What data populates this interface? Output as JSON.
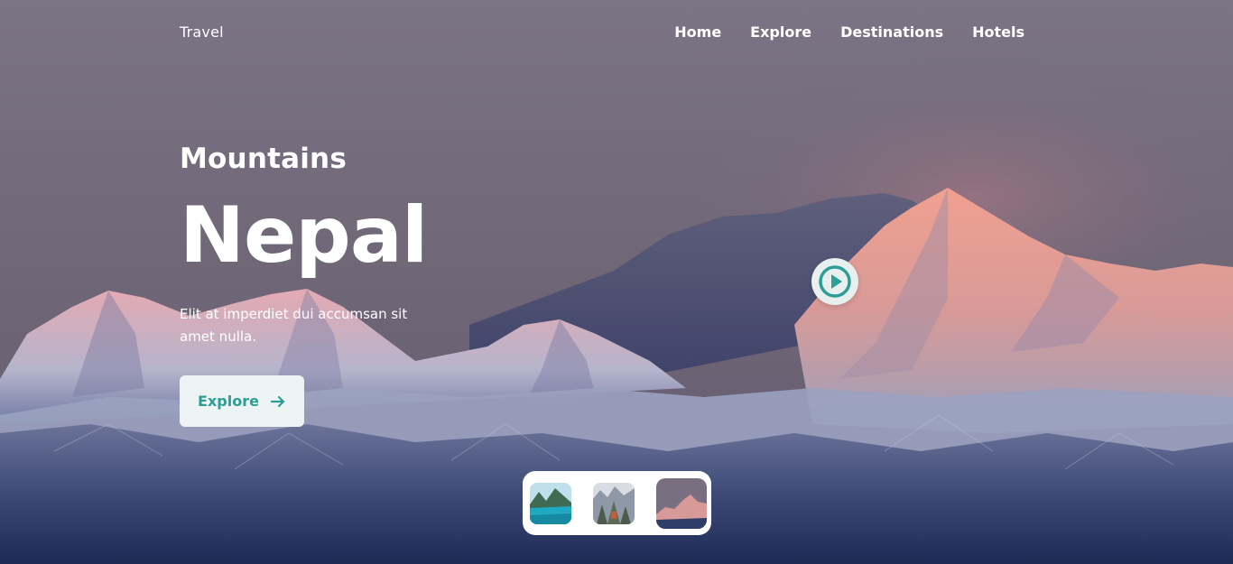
{
  "header": {
    "brand": "Travel",
    "nav": [
      "Home",
      "Explore",
      "Destinations",
      "Hotels"
    ]
  },
  "hero": {
    "subtitle": "Mountains",
    "title": "Nepal",
    "description": "Elit at imperdiet dui accumsan sit amet nulla.",
    "cta_label": "Explore",
    "cta_icon": "arrow-right-icon",
    "play_icon": "play-circle-icon"
  },
  "thumbnails": {
    "items": [
      "lake-thumbnail",
      "forest-thumbnail",
      "mountain-thumbnail"
    ]
  },
  "colors": {
    "accent": "#2b9f95",
    "button_bg": "#eef3f3",
    "sky": "#7a6f80",
    "snow_glow": "#e08a7c",
    "shadow_blue": "#2f3d6b"
  }
}
